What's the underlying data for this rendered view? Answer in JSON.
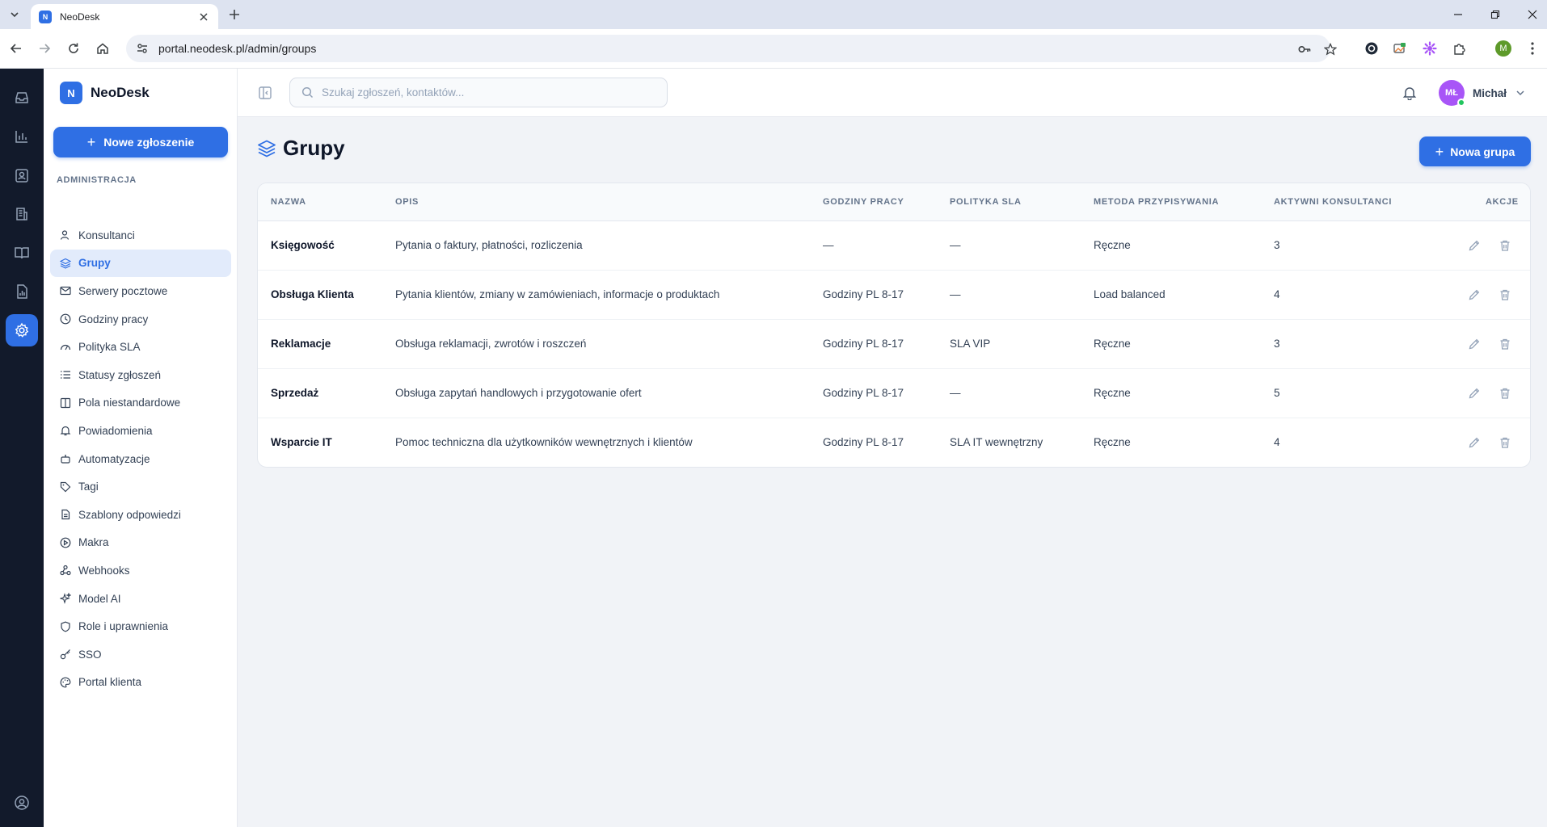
{
  "browser": {
    "tab_title": "NeoDesk",
    "tab_favicon": "N",
    "url": "portal.neodesk.pl/admin/groups",
    "profile_initial": "M"
  },
  "brand": {
    "logo_letter": "N",
    "name": "NeoDesk",
    "color": "#2f6fe4"
  },
  "sidebar": {
    "new_ticket_label": "Nowe zgłoszenie",
    "section_label": "ADMINISTRACJA",
    "items": [
      {
        "label": "Konsultanci",
        "icon": "users-icon"
      },
      {
        "label": "Grupy",
        "icon": "layers-icon",
        "active": true
      },
      {
        "label": "Serwery pocztowe",
        "icon": "mail-icon"
      },
      {
        "label": "Godziny pracy",
        "icon": "clock-icon"
      },
      {
        "label": "Polityka SLA",
        "icon": "gauge-icon"
      },
      {
        "label": "Statusy zgłoszeń",
        "icon": "list-icon"
      },
      {
        "label": "Pola niestandardowe",
        "icon": "columns-icon"
      },
      {
        "label": "Powiadomienia",
        "icon": "bell-icon"
      },
      {
        "label": "Automatyzacje",
        "icon": "robot-icon"
      },
      {
        "label": "Tagi",
        "icon": "tag-icon"
      },
      {
        "label": "Szablony odpowiedzi",
        "icon": "file-icon"
      },
      {
        "label": "Makra",
        "icon": "play-circle-icon"
      },
      {
        "label": "Webhooks",
        "icon": "webhook-icon"
      },
      {
        "label": "Model AI",
        "icon": "sparkles-icon"
      },
      {
        "label": "Role i uprawnienia",
        "icon": "shield-icon"
      },
      {
        "label": "SSO",
        "icon": "key-icon"
      },
      {
        "label": "Portal klienta",
        "icon": "palette-icon"
      }
    ]
  },
  "topbar": {
    "search_placeholder": "Szukaj zgłoszeń, kontaktów...",
    "user_initials": "MŁ",
    "user_name": "Michał"
  },
  "page": {
    "title": "Grupy",
    "new_group_label": "Nowa grupa"
  },
  "table": {
    "headers": {
      "name": "NAZWA",
      "desc": "OPIS",
      "hours": "GODZINY PRACY",
      "sla": "POLITYKA SLA",
      "method": "METODA PRZYPISYWANIA",
      "agents": "AKTYWNI KONSULTANCI",
      "actions": "AKCJE"
    },
    "rows": [
      {
        "name": "Księgowość",
        "desc": "Pytania o faktury, płatności, rozliczenia",
        "hours": "—",
        "sla": "—",
        "method": "Ręczne",
        "agents": "3"
      },
      {
        "name": "Obsługa Klienta",
        "desc": "Pytania klientów, zmiany w zamówieniach, informacje o produktach",
        "hours": "Godziny PL 8-17",
        "sla": "—",
        "method": "Load balanced",
        "agents": "4"
      },
      {
        "name": "Reklamacje",
        "desc": "Obsługa reklamacji, zwrotów i roszczeń",
        "hours": "Godziny PL 8-17",
        "sla": "SLA VIP",
        "method": "Ręczne",
        "agents": "3"
      },
      {
        "name": "Sprzedaż",
        "desc": "Obsługa zapytań handlowych i przygotowanie ofert",
        "hours": "Godziny PL 8-17",
        "sla": "—",
        "method": "Ręczne",
        "agents": "5"
      },
      {
        "name": "Wsparcie IT",
        "desc": "Pomoc techniczna dla użytkowników wewnętrznych i klientów",
        "hours": "Godziny PL 8-17",
        "sla": "SLA IT wewnętrzny",
        "method": "Ręczne",
        "agents": "4"
      }
    ]
  }
}
